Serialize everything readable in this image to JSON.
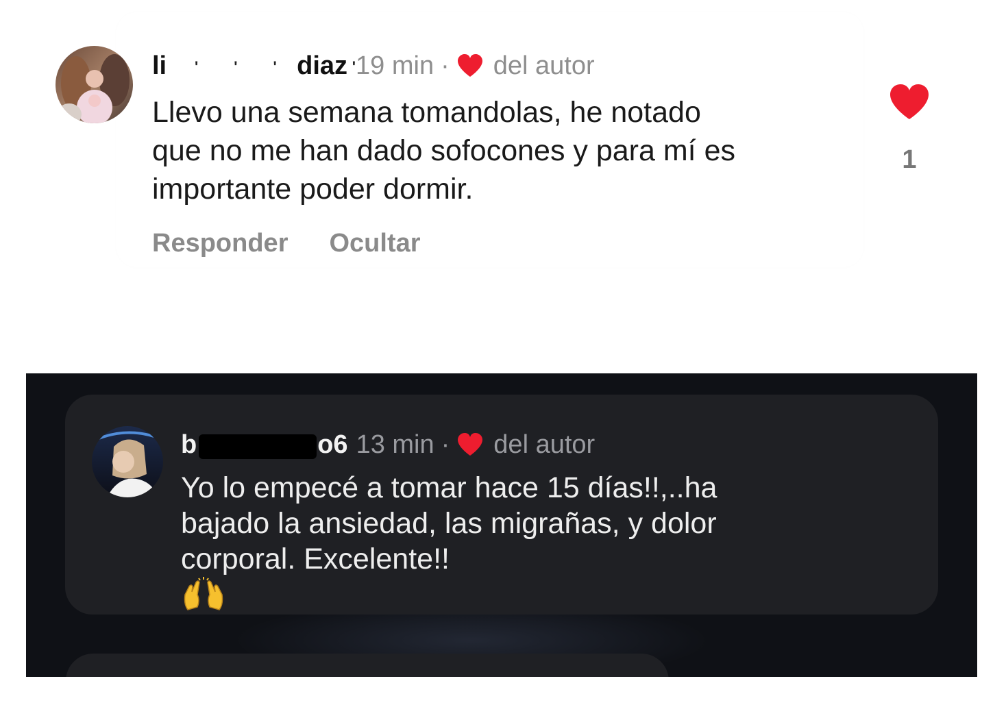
{
  "comments": [
    {
      "username_visible": "li diaz",
      "username_start": "li",
      "username_end": "diaz",
      "time": "19 min",
      "separator": "·",
      "author_label": "del autor",
      "text_lines": [
        "Llevo una semana tomandolas, he notado",
        "que no me han dado sofocones y para mí es",
        "importante poder dormir."
      ],
      "actions": {
        "reply": "Responder",
        "hide": "Ocultar"
      },
      "likes": "1",
      "theme": "light"
    },
    {
      "username_start": "b",
      "username_end": "o6",
      "time": "13 min",
      "separator": "·",
      "author_label": "del autor",
      "text_lines": [
        "Yo lo empecé a tomar hace 15 días!!,..ha",
        "bajado la ansiedad, las migrañas, y dolor",
        "corporal. Excelente!!"
      ],
      "emoji": "raising-hands-icon",
      "theme": "dark"
    }
  ],
  "colors": {
    "heart_red": "#ee1d2f",
    "dark_background": "#0f1116",
    "dark_card": "#1f2024",
    "muted_text": "#8e8e8e"
  }
}
